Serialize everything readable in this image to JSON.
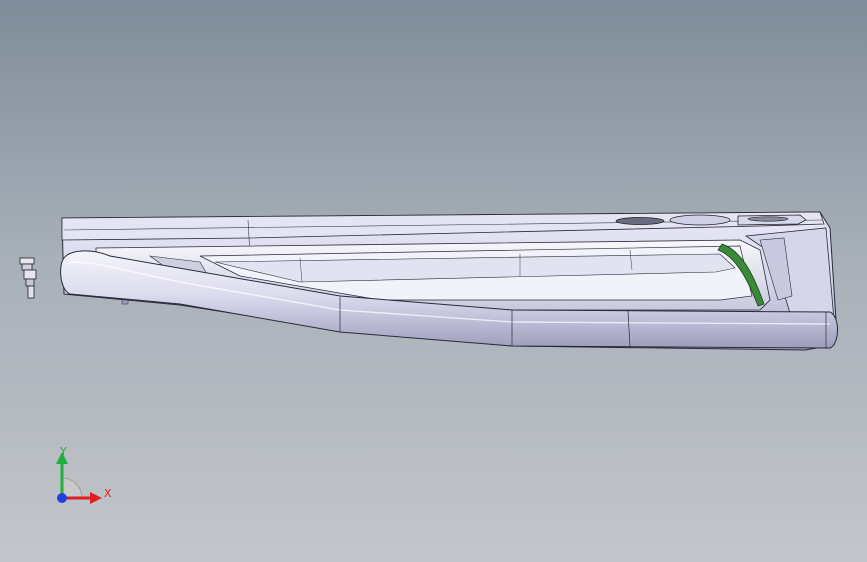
{
  "viewport": {
    "background_top": "#7f8c99",
    "background_bottom": "#c3c6ca"
  },
  "model": {
    "body_color": "#d9d9ef",
    "shadow_color": "#9d9db8",
    "edge_color": "#2a2a3a",
    "highlight_color": "#3a8a3a"
  },
  "triad": {
    "x_label": "X",
    "y_label": "Y",
    "x_color": "#e02020",
    "y_color": "#20b040",
    "z_color": "#2040e0"
  }
}
